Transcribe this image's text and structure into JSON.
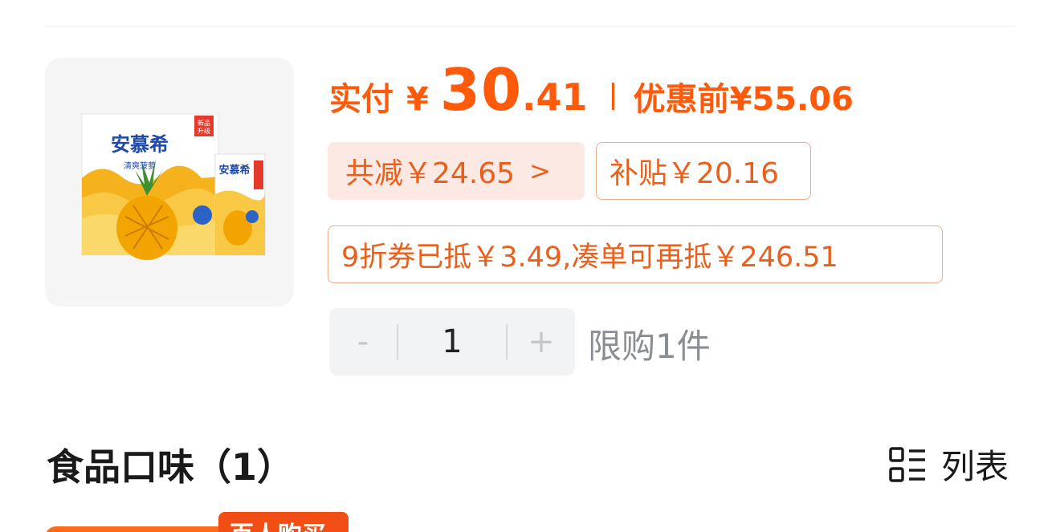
{
  "product": {
    "image_alt": "pineapple-yogurt-box",
    "box_brand": "安慕希",
    "box_sub": "清爽菠萝",
    "box_badge": "新品升级",
    "carton_brand": "安慕希"
  },
  "price": {
    "paid_label": "实付",
    "currency": "¥",
    "paid_int": "30",
    "paid_dec": ".41",
    "original_label": "优惠前",
    "original_value": "¥55.06"
  },
  "chips": {
    "total_discount": "共减￥24.65",
    "subsidy": "补贴￥20.16",
    "coupon": "9折券已抵￥3.49,凑单可再抵￥246.51"
  },
  "quantity": {
    "minus": "-",
    "value": "1",
    "plus": "+",
    "limit": "限购1件"
  },
  "section": {
    "title": "食品口味（1）",
    "view_label": "列表"
  },
  "badge": {
    "popular": "百人购买"
  },
  "colors": {
    "accent": "#ff5a0a",
    "chip_text": "#e8601c",
    "chip_bg": "#fde9e3",
    "chip_border": "#f2a98a"
  }
}
